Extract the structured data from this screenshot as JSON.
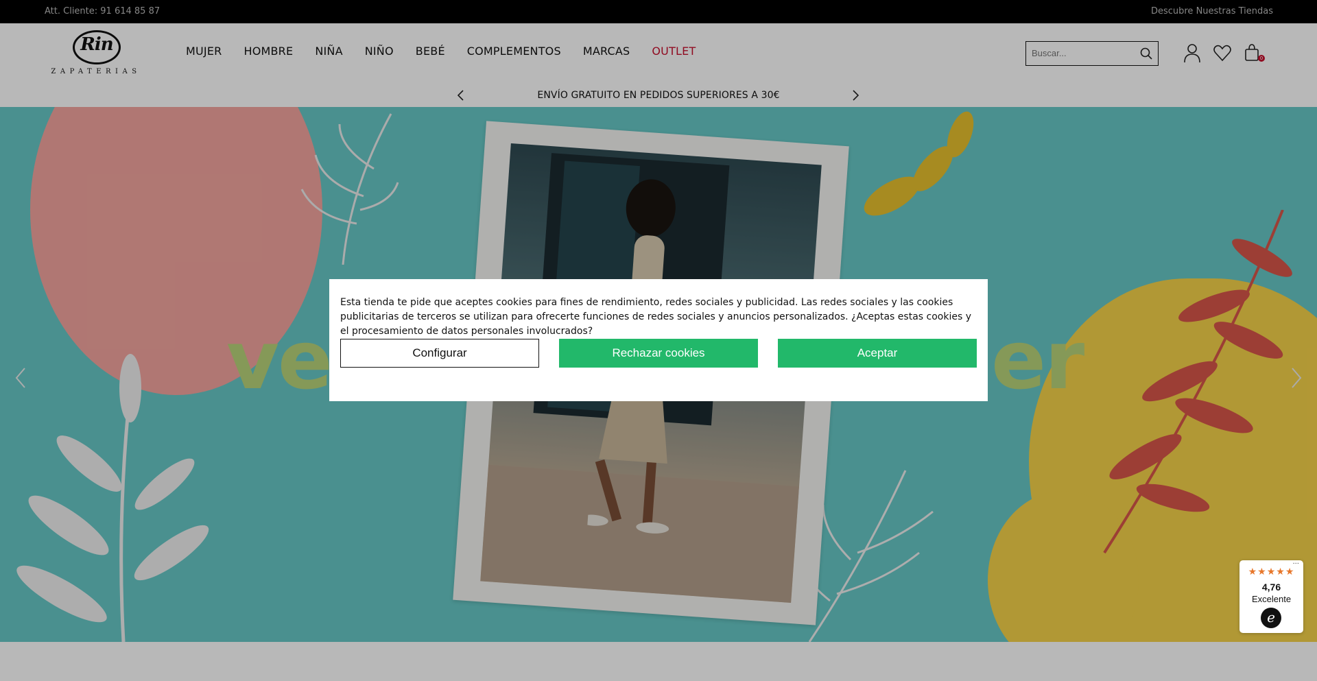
{
  "topbar": {
    "phone": "Att. Cliente: 91 614 85 87",
    "stores_link": "Descubre Nuestras Tiendas"
  },
  "header": {
    "logo_text": "Rin",
    "logo_subtext": "ZAPATERIAS",
    "nav": [
      "MUJER",
      "HOMBRE",
      "NIÑA",
      "NIÑO",
      "BEBÉ",
      "COMPLEMENTOS",
      "MARCAS",
      "OUTLET"
    ],
    "search_placeholder": "Buscar...",
    "cart_count": "0",
    "icons": [
      "search-icon",
      "user-icon",
      "heart-icon",
      "bag-icon"
    ]
  },
  "announcement": {
    "text": "ENVÍO GRATUITO EN PEDIDOS SUPERIORES A 30€"
  },
  "hero": {
    "word_left": "ve",
    "word_right": "er"
  },
  "cookie_modal": {
    "message": "Esta tienda te pide que aceptes cookies para fines de rendimiento, redes sociales y publicidad. Las redes sociales y las cookies publicitarias de terceros se utilizan para ofrecerte funciones de redes sociales y anuncios personalizados. ¿Aceptas estas cookies y el procesamiento de datos personales involucrados?",
    "configure_label": "Configurar",
    "reject_label": "Rechazar cookies",
    "accept_label": "Aceptar"
  },
  "rating_widget": {
    "stars": "★★★★★",
    "score": "4,76",
    "label": "Excelente",
    "more": "···",
    "badge": "e"
  },
  "colors": {
    "outlet": "#c8102e",
    "accept_green": "#22b86a",
    "hero_teal": "#67c8c6"
  }
}
